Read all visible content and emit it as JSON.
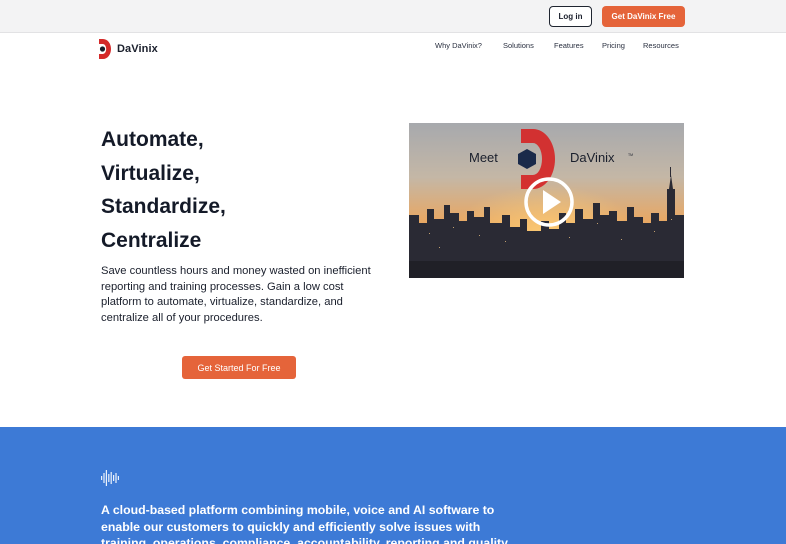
{
  "header": {
    "login_label": "Log in",
    "cta_label": "Get DaVinix Free"
  },
  "brand": {
    "name": "DaVinix",
    "accent_color": "#e5643a",
    "logo_red": "#d42a2a"
  },
  "nav": {
    "items": [
      {
        "label": "Why DaVinix?"
      },
      {
        "label": "Solutions"
      },
      {
        "label": "Features"
      },
      {
        "label": "Pricing"
      },
      {
        "label": "Resources"
      }
    ]
  },
  "hero": {
    "title_lines": [
      "Automate,",
      "Virtualize,",
      "Standardize,",
      "Centralize"
    ],
    "description": "Save countless hours and money wasted on inefficient reporting and training processes. Gain a low cost platform to automate, virtualize, standardize, and centralize all of your procedures.",
    "cta_label": "Get Started For Free"
  },
  "video": {
    "text_left": "Meet",
    "text_right": "DaVinix",
    "trademark": "TM",
    "icon": "play-icon"
  },
  "section2": {
    "background": "#3d7ad6",
    "icon": "sound-wave-icon",
    "text": "A cloud-based platform combining mobile, voice and AI software to enable our customers to quickly and efficiently solve issues with training, operations, compliance, accountability, reporting and quality."
  }
}
